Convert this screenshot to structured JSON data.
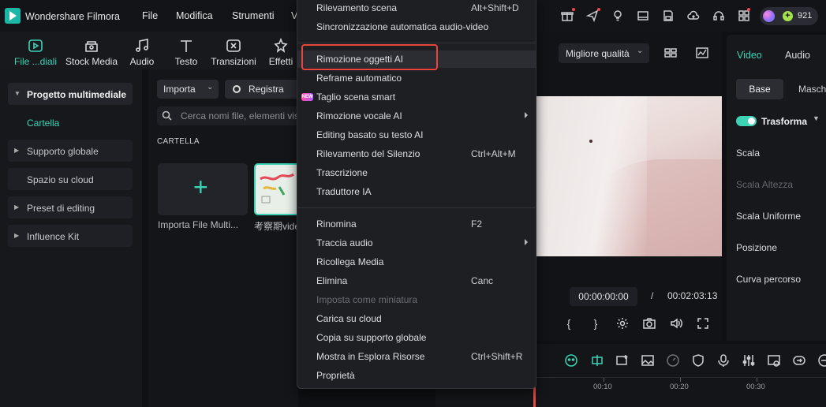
{
  "app": {
    "title": "Wondershare Filmora"
  },
  "menubar": [
    "File",
    "Modifica",
    "Strumenti",
    "V"
  ],
  "credits": {
    "count": "921"
  },
  "toolbar": [
    {
      "label": "File ...diali",
      "icon": "media-icon",
      "active": true
    },
    {
      "label": "Stock Media",
      "icon": "stock-media-icon"
    },
    {
      "label": "Audio",
      "icon": "music-icon"
    },
    {
      "label": "Testo",
      "icon": "text-icon"
    },
    {
      "label": "Transizioni",
      "icon": "transitions-icon"
    },
    {
      "label": "Effetti",
      "icon": "effects-icon"
    }
  ],
  "sidebar": {
    "items": [
      {
        "label": "Progetto multimediale",
        "expanded": true
      },
      {
        "label": "Supporto globale",
        "expanded": false
      },
      {
        "label": "Spazio su cloud",
        "expanded": false
      },
      {
        "label": "Preset di editing",
        "expanded": false
      },
      {
        "label": "Influence Kit",
        "expanded": false
      }
    ],
    "sub_item": "Cartella"
  },
  "media": {
    "import_label": "Importa",
    "record_label": "Registra",
    "search_placeholder": "Cerca nomi file, elementi vis",
    "folder_heading": "CARTELLA",
    "tiles": [
      {
        "label": "Importa File Multi..."
      },
      {
        "label": "考察期vide"
      }
    ]
  },
  "preview": {
    "quality": "Migliore qualità",
    "current_time": "00:00:00:00",
    "separator": "/",
    "total_time": "00:02:03:13"
  },
  "right_panel": {
    "tabs": [
      "Video",
      "Audio"
    ],
    "subtabs": [
      "Base",
      "Masch"
    ],
    "section": "Trasforma",
    "rows": [
      "Scala",
      "Scala Altezza",
      "Scala Uniforme",
      "Posizione",
      "Curva percorso"
    ]
  },
  "timeline": {
    "ruler": [
      "00:10",
      "00:20",
      "00:30"
    ]
  },
  "context_menu": {
    "items": [
      {
        "label": "Rilevamento scena",
        "shortcut": "Alt+Shift+D"
      },
      {
        "label": "Sincronizzazione automatica audio-video",
        "shortcut": ""
      },
      {
        "separator": true
      },
      {
        "label": "Rimozione oggetti AI",
        "shortcut": "",
        "highlighted": true
      },
      {
        "label": "Reframe automatico",
        "shortcut": ""
      },
      {
        "label": "Taglio scena smart",
        "shortcut": "",
        "badge": "NEW"
      },
      {
        "label": "Rimozione vocale AI",
        "shortcut": "",
        "submenu": true
      },
      {
        "label": "Editing basato su testo AI",
        "shortcut": ""
      },
      {
        "label": "Rilevamento del Silenzio",
        "shortcut": "Ctrl+Alt+M"
      },
      {
        "label": "Trascrizione",
        "shortcut": ""
      },
      {
        "label": "Traduttore IA",
        "shortcut": ""
      },
      {
        "separator": true
      },
      {
        "label": "Rinomina",
        "shortcut": "F2"
      },
      {
        "label": "Traccia audio",
        "shortcut": "",
        "submenu": true
      },
      {
        "label": "Ricollega Media",
        "shortcut": ""
      },
      {
        "label": "Elimina",
        "shortcut": "Canc"
      },
      {
        "label": "Imposta come miniatura",
        "shortcut": "",
        "disabled": true
      },
      {
        "label": "Carica su cloud",
        "shortcut": ""
      },
      {
        "label": "Copia su supporto globale",
        "shortcut": ""
      },
      {
        "label": "Mostra in Esplora Risorse",
        "shortcut": "Ctrl+Shift+R"
      },
      {
        "label": "Proprietà",
        "shortcut": ""
      }
    ]
  },
  "colors": {
    "accent": "#3cd4b5",
    "highlight_border": "#e8463c"
  }
}
